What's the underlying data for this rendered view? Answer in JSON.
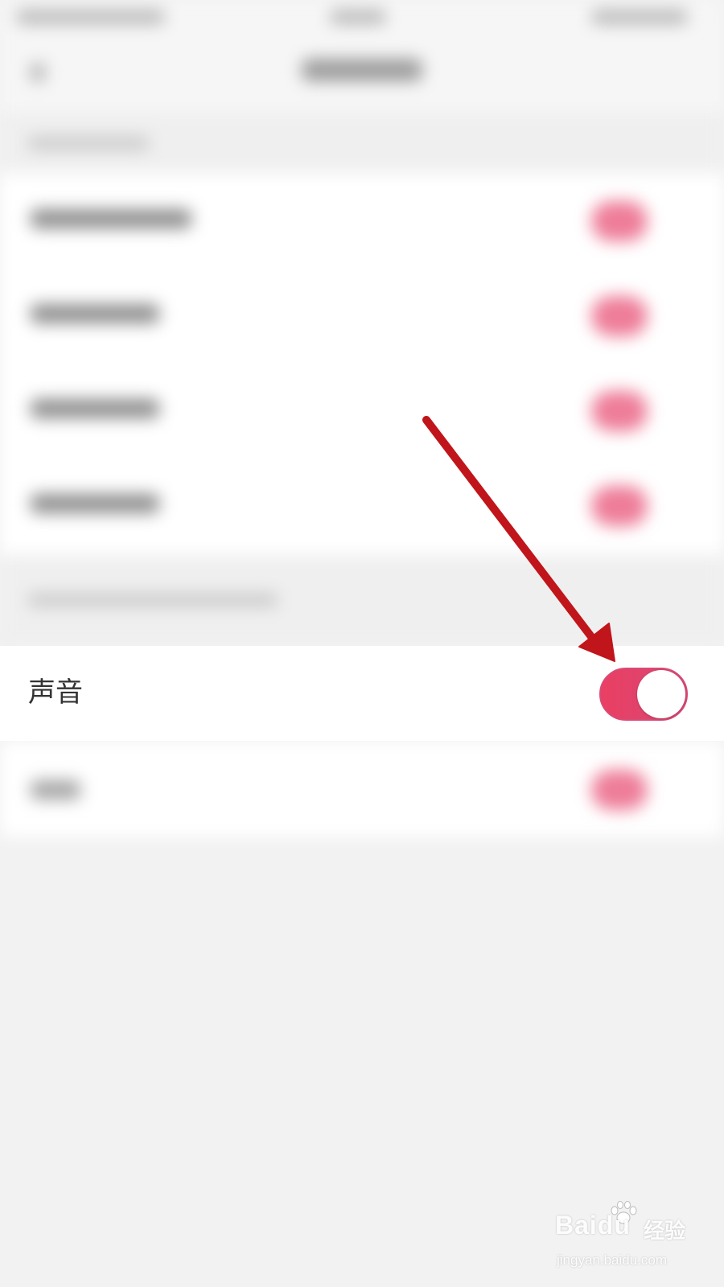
{
  "settings": {
    "sound_row": {
      "label": "声音",
      "toggle_on": true
    }
  },
  "colors": {
    "toggle_on": "#ea3f63",
    "annotation_arrow": "#c0151a",
    "page_background": "#f2f2f2"
  },
  "icons": {
    "annotation": "arrow-icon",
    "watermark_logo": "baidu-paw-icon"
  },
  "watermark": {
    "brand": "Baidu",
    "service": "经验",
    "url": "jingyan.baidu.com"
  }
}
